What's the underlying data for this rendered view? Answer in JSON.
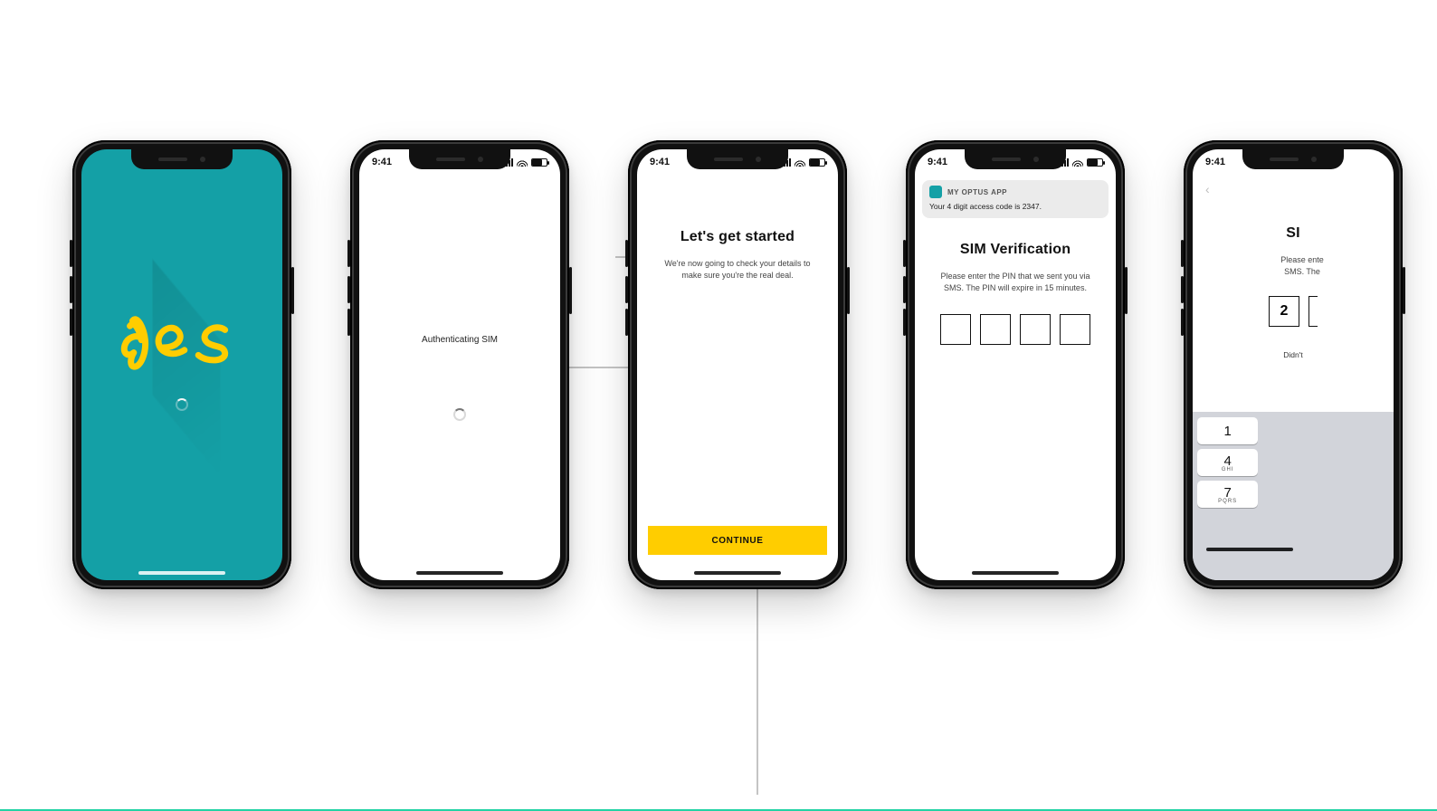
{
  "status_time": "9:41",
  "screens": {
    "splash": {
      "logo_text": "yes"
    },
    "auth": {
      "label": "Authenticating SIM"
    },
    "start": {
      "title": "Let's get started",
      "subtitle": "We're now going to check your details to make sure you're the real deal.",
      "cta": "CONTINUE"
    },
    "verify1": {
      "notif_app": "MY OPTUS APP",
      "notif_body": "Your 4 digit access code is 2347.",
      "title": "SIM Verification",
      "subtitle": "Please enter the PIN that we sent you via SMS. The PIN will expire in 15 minutes.",
      "pins": [
        "",
        "",
        "",
        ""
      ]
    },
    "verify2": {
      "title_partial": "SI",
      "subtitle_l1": "Please ente",
      "subtitle_l2": "SMS. The",
      "resend_partial": "Didn't",
      "pin0": "2",
      "keys": {
        "k1": "1",
        "k4": "4",
        "k7": "7",
        "k4s": "GHI",
        "k7s": "PQRS"
      }
    }
  }
}
